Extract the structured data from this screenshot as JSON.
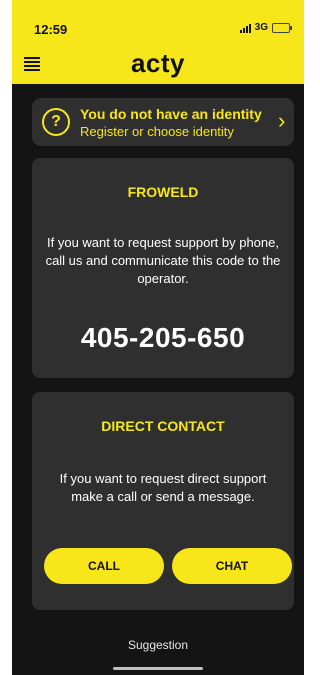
{
  "status_bar": {
    "time": "12:59",
    "network": "3G"
  },
  "header": {
    "title": "acty"
  },
  "identity_banner": {
    "title": "You do not have an identity",
    "subtitle": "Register or choose identity",
    "icon": "?"
  },
  "support_card": {
    "title": "FROWELD",
    "text": "If you want to request support by phone, call us and communicate this code to the operator.",
    "code": "405-205-650"
  },
  "direct_contact_card": {
    "title": "DIRECT CONTACT",
    "text": "If you want to request direct support make a call or send a message.",
    "call_label": "CALL",
    "chat_label": "CHAT"
  },
  "footer": {
    "suggestion_label": "Suggestion"
  },
  "colors": {
    "accent": "#f7e71a",
    "background": "#141414",
    "card": "#2f2f2f",
    "text": "#ffffff"
  }
}
